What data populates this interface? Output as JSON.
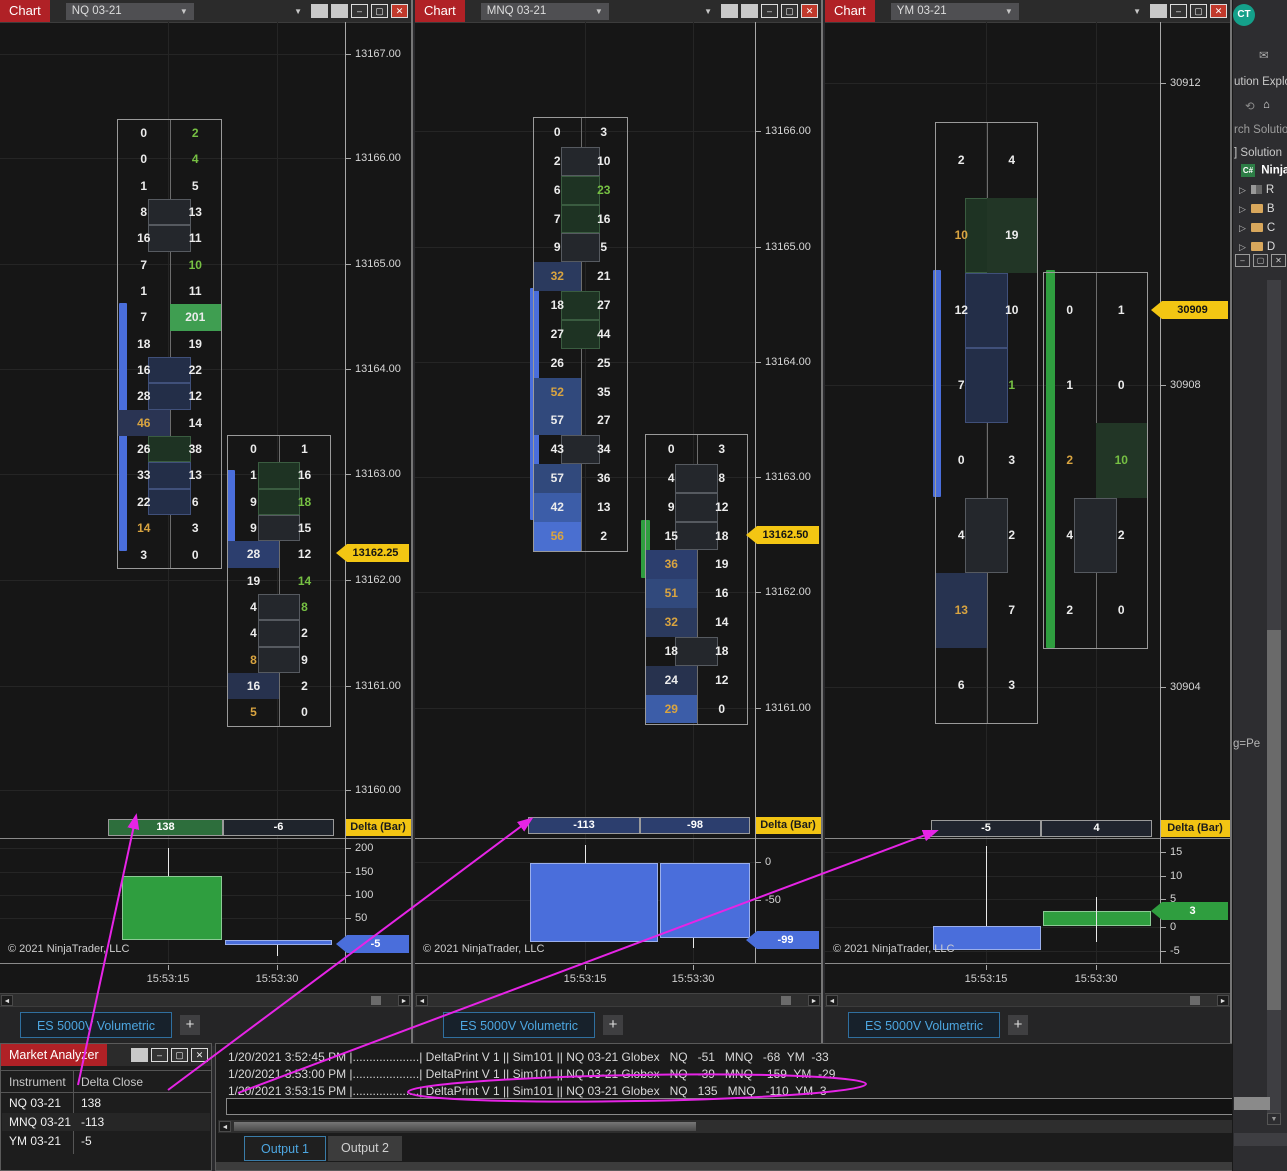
{
  "colors": {
    "accent_red": "#b02126",
    "marker_yellow": "#f3c613",
    "marker_blue": "#4a6edb",
    "marker_green": "#2f9e3f",
    "volume_blue": "#4a6edb",
    "volume_green": "#2f9e3f",
    "text_green": "#76c043",
    "text_orange": "#d9a440",
    "annotation_magenta": "#e624e6"
  },
  "glyphs": {
    "close": "✕",
    "minimize": "–",
    "maximize": "▢",
    "caret": "▼",
    "scroll_left": "◄",
    "scroll_right": "►",
    "scroll_up": "▲",
    "scroll_down": "▼",
    "tree_arrow": "▷",
    "home": "⌂",
    "back": "⟲",
    "mail": "✉",
    "plus": "+",
    "bracket": "]",
    "csharp": "C#"
  },
  "charts": [
    {
      "title_label": "Chart",
      "instrument": "NQ 03-21",
      "price_ticks": [
        "13167.00",
        "13166.00",
        "13165.00",
        "13164.00",
        "13163.00",
        "13162.00",
        "13161.00",
        "13160.00"
      ],
      "price_marker": "13162.25",
      "delta_ticks": [
        "200",
        "150",
        "100",
        "50"
      ],
      "delta_marker": "-5",
      "delta_row": [
        "138",
        "-6"
      ],
      "delta_label": "Delta (Bar)",
      "times": [
        "15:53:15",
        "15:53:30"
      ],
      "copyright": "© 2021 NinjaTrader, LLC",
      "tab_label": "ES 5000V Volumetric",
      "bars": [
        {
          "rows": [
            {
              "b": "0",
              "a": "2",
              "ac": "g"
            },
            {
              "b": "0",
              "a": "4",
              "ac": "g"
            },
            {
              "b": "1",
              "a": "5"
            },
            {
              "b": "8",
              "a": "13",
              "body": "gray"
            },
            {
              "b": "16",
              "a": "11",
              "body": "gray"
            },
            {
              "b": "7",
              "a": "10",
              "ac": "g"
            },
            {
              "b": "1",
              "a": "11"
            },
            {
              "b": "7",
              "a": "201",
              "abg": "#3f9e51"
            },
            {
              "b": "18",
              "a": "19"
            },
            {
              "b": "16",
              "a": "22",
              "body": "navy"
            },
            {
              "b": "28",
              "a": "12",
              "body": "navy"
            },
            {
              "b": "46",
              "bc": "o",
              "a": "14",
              "bbg": "#2a3453"
            },
            {
              "b": "26",
              "a": "38",
              "body": "green"
            },
            {
              "b": "33",
              "a": "13",
              "body": "navy"
            },
            {
              "b": "22",
              "a": "6",
              "body": "navy"
            },
            {
              "b": "14",
              "bc": "o",
              "a": "3"
            },
            {
              "b": "3",
              "a": "0"
            }
          ]
        },
        {
          "rows": [
            {
              "b": "0",
              "a": "1"
            },
            {
              "b": "1",
              "a": "16",
              "body": "green"
            },
            {
              "b": "9",
              "a": "18",
              "ac": "g",
              "body": "green"
            },
            {
              "b": "9",
              "a": "15",
              "body": "gray"
            },
            {
              "b": "28",
              "a": "12",
              "bbg": "#2c3e6e"
            },
            {
              "b": "19",
              "a": "14",
              "ac": "g"
            },
            {
              "b": "4",
              "a": "8",
              "ac": "g",
              "body": "gray"
            },
            {
              "b": "4",
              "a": "2",
              "body": "gray"
            },
            {
              "b": "8",
              "bc": "o",
              "a": "9",
              "body": "gray"
            },
            {
              "b": "16",
              "a": "2",
              "bbg": "#27324e"
            },
            {
              "b": "5",
              "bc": "o",
              "a": "0"
            }
          ]
        }
      ]
    },
    {
      "title_label": "Chart",
      "instrument": "MNQ 03-21",
      "price_ticks": [
        "13166.00",
        "13165.00",
        "13164.00",
        "13163.00",
        "13162.00",
        "13161.00"
      ],
      "price_marker": "13162.50",
      "delta_ticks": [
        "0",
        "-50"
      ],
      "delta_marker": "-99",
      "delta_row": [
        "-113",
        "-98"
      ],
      "delta_label": "Delta (Bar)",
      "times": [
        "15:53:15",
        "15:53:30"
      ],
      "copyright": "© 2021 NinjaTrader, LLC",
      "tab_label": "ES 5000V Volumetric",
      "bars": [
        {
          "rows": [
            {
              "b": "0",
              "a": "3"
            },
            {
              "b": "2",
              "a": "10",
              "body": "gray"
            },
            {
              "b": "6",
              "a": "23",
              "ac": "g",
              "body": "green"
            },
            {
              "b": "7",
              "a": "16",
              "body": "green"
            },
            {
              "b": "9",
              "a": "5",
              "body": "gray"
            },
            {
              "b": "32",
              "bc": "o",
              "a": "21",
              "bbg": "#2b3a5e"
            },
            {
              "b": "18",
              "a": "27",
              "body": "green"
            },
            {
              "b": "27",
              "a": "44",
              "body": "green"
            },
            {
              "b": "26",
              "a": "25"
            },
            {
              "b": "52",
              "bc": "o",
              "a": "35",
              "bbg": "#31497c"
            },
            {
              "b": "57",
              "a": "27",
              "bbg": "#31497c"
            },
            {
              "b": "43",
              "a": "34",
              "body": "gray"
            },
            {
              "b": "57",
              "a": "36",
              "bbg": "#31497c"
            },
            {
              "b": "42",
              "a": "13",
              "bbg": "#3c5da8"
            },
            {
              "b": "56",
              "bc": "o",
              "a": "2",
              "bbg": "#4a6fd0"
            }
          ]
        },
        {
          "rows": [
            {
              "b": "0",
              "a": "3"
            },
            {
              "b": "4",
              "a": "8",
              "body": "gray"
            },
            {
              "b": "9",
              "a": "12",
              "body": "gray"
            },
            {
              "b": "15",
              "a": "18",
              "body": "gray"
            },
            {
              "b": "36",
              "bc": "o",
              "a": "19",
              "bbg": "#2c3e6e"
            },
            {
              "b": "51",
              "bc": "o",
              "a": "16",
              "bbg": "#31497c"
            },
            {
              "b": "32",
              "bc": "o",
              "a": "14",
              "bbg": "#2b3a5e"
            },
            {
              "b": "18",
              "a": "18",
              "body": "gray"
            },
            {
              "b": "24",
              "a": "12",
              "bbg": "#27324e"
            },
            {
              "b": "29",
              "bc": "o",
              "a": "0",
              "bbg": "#3c5da8"
            }
          ]
        }
      ]
    },
    {
      "title_label": "Chart",
      "instrument": "YM 03-21",
      "price_ticks": [
        "30912",
        "30908",
        "30904"
      ],
      "price_marker": "30909",
      "delta_ticks": [
        "15",
        "10",
        "5",
        "0",
        "-5"
      ],
      "delta_marker": "3",
      "delta_row": [
        "-5",
        "4"
      ],
      "delta_label": "Delta (Bar)",
      "times": [
        "15:53:15",
        "15:53:30"
      ],
      "copyright": "© 2021 NinjaTrader, LLC",
      "tab_label": "ES 5000V Volumetric",
      "bars": [
        {
          "rows": [
            {
              "b": "2",
              "a": "4"
            },
            {
              "b": "10",
              "bc": "o",
              "a": "19",
              "abg": "#223626",
              "body": "green"
            },
            {
              "b": "12",
              "a": "10",
              "body": "navy"
            },
            {
              "b": "7",
              "a": "1",
              "ac": "g",
              "body": "navy"
            },
            {
              "b": "0",
              "a": "3"
            },
            {
              "b": "4",
              "a": "2",
              "body": "gray"
            },
            {
              "b": "13",
              "bc": "o",
              "a": "7",
              "bbg": "#273350"
            },
            {
              "b": "6",
              "a": "3"
            }
          ]
        },
        {
          "rows": [
            {
              "b": "0",
              "a": "1"
            },
            {
              "b": "1",
              "a": "0"
            },
            {
              "b": "2",
              "bc": "o",
              "a": "10",
              "ac": "g",
              "abg": "#223626"
            },
            {
              "b": "4",
              "a": "2",
              "body": "gray"
            },
            {
              "b": "2",
              "a": "0"
            }
          ]
        }
      ]
    }
  ],
  "chart_data": [
    {
      "type": "bar",
      "title": "NQ 03-21 Delta (Bar)",
      "x": [
        "15:53:15",
        "15:53:30"
      ],
      "values": [
        138,
        -6
      ],
      "ylim": [
        -50,
        200
      ],
      "current_value": -5
    },
    {
      "type": "bar",
      "title": "MNQ 03-21 Delta (Bar)",
      "x": [
        "15:53:15",
        "15:53:30"
      ],
      "values": [
        -113,
        -98
      ],
      "ylim": [
        -130,
        0
      ],
      "current_value": -99
    },
    {
      "type": "bar",
      "title": "YM 03-21 Delta (Bar)",
      "x": [
        "15:53:15",
        "15:53:30"
      ],
      "values": [
        -5,
        4
      ],
      "ylim": [
        -5,
        15
      ],
      "current_value": 3
    }
  ],
  "market_analyzer": {
    "title": "Market Analyzer",
    "columns": [
      "Instrument",
      "Delta Close"
    ],
    "rows": [
      [
        "NQ 03-21",
        "138"
      ],
      [
        "MNQ 03-21",
        "-113"
      ],
      [
        "YM 03-21",
        "-5"
      ]
    ]
  },
  "output": {
    "lines": [
      "1/20/2021 3:52:45 PM |....................| DeltaPrint V 1 || Sim101 || NQ 03-21 Globex   NQ   -51   MNQ   -68  YM  -33",
      "1/20/2021 3:53:00 PM |....................| DeltaPrint V 1 || Sim101 || NQ 03-21 Globex   NQ   -39   MNQ   -159  YM  -29",
      "1/20/2021 3:53:15 PM |....................| DeltaPrint V 1 || Sim101 || NQ 03-21 Globex   NQ   135   MNQ   -110  YM  3"
    ],
    "tabs": [
      "Output 1",
      "Output 2"
    ],
    "active_tab": "Output 1"
  },
  "side_panel": {
    "badge": "CT",
    "explorer_fragment": "ution Explo",
    "search_fragment": "rch Solutio",
    "solution_fragment": "Solution",
    "project_fragment": "Ninja",
    "tree_items": [
      "R",
      "B",
      "C",
      "D"
    ],
    "text_fragment": "g=Pe"
  }
}
